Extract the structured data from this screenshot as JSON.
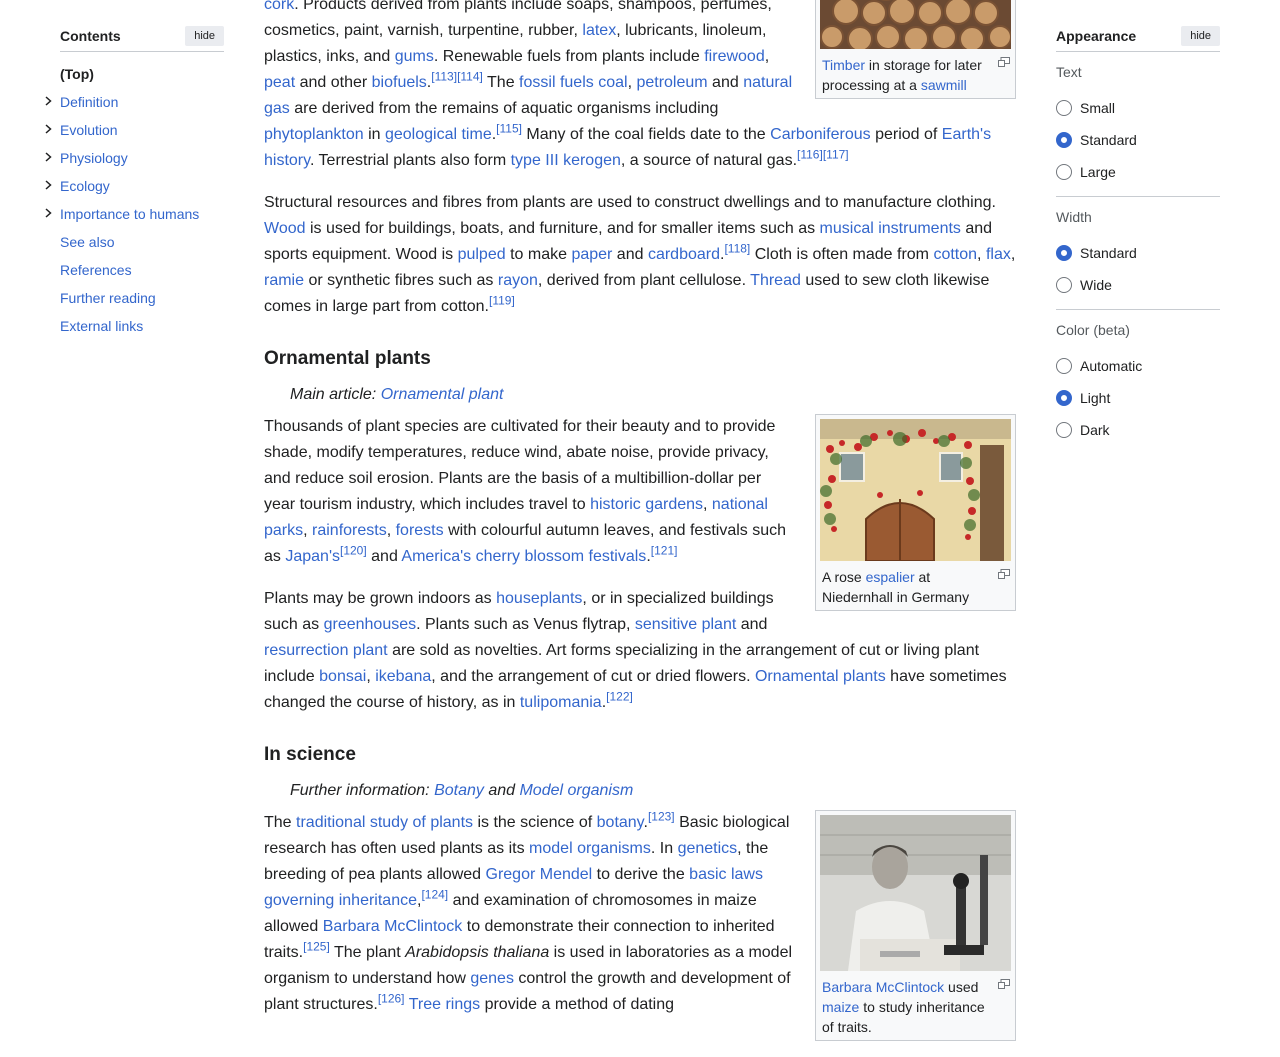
{
  "toc": {
    "title": "Contents",
    "hide_label": "hide",
    "top": "(Top)",
    "items": [
      {
        "label": "Definition",
        "expandable": true
      },
      {
        "label": "Evolution",
        "expandable": true
      },
      {
        "label": "Physiology",
        "expandable": true
      },
      {
        "label": "Ecology",
        "expandable": true
      },
      {
        "label": "Importance to humans",
        "expandable": true
      },
      {
        "label": "See also",
        "expandable": false
      },
      {
        "label": "References",
        "expandable": false
      },
      {
        "label": "Further reading",
        "expandable": false
      },
      {
        "label": "External links",
        "expandable": false
      }
    ]
  },
  "appearance": {
    "title": "Appearance",
    "hide_label": "hide",
    "text": {
      "label": "Text",
      "options": [
        "Small",
        "Standard",
        "Large"
      ],
      "selected": "Standard"
    },
    "width": {
      "label": "Width",
      "options": [
        "Standard",
        "Wide"
      ],
      "selected": "Standard"
    },
    "color": {
      "label": "Color (beta)",
      "options": [
        "Automatic",
        "Light",
        "Dark"
      ],
      "selected": "Light"
    }
  },
  "figures": {
    "timber": {
      "caption_link": "Timber",
      "caption_text": " in storage for later processing at a ",
      "caption_link2": "sawmill"
    },
    "rose": {
      "caption_pre": "A rose ",
      "caption_link": "espalier",
      "caption_text": " at Niedernhall in Germany"
    },
    "mcclintock": {
      "caption_link": "Barbara McClintock",
      "caption_text": " used ",
      "caption_link2": "maize",
      "caption_text2": " to study inheritance of traits."
    }
  },
  "article": {
    "p1": [
      {
        "t": "cork",
        "link": true
      },
      {
        "t": ". Products derived from plants include soaps, shampoos, perfumes, cosmetics, paint, varnish, turpentine, rubber, "
      },
      {
        "t": "latex",
        "link": true
      },
      {
        "t": ", lubricants, linoleum, plastics, inks, and "
      },
      {
        "t": "gums",
        "link": true
      },
      {
        "t": ". Renewable fuels from plants include "
      },
      {
        "t": "firewood",
        "link": true
      },
      {
        "t": ", "
      },
      {
        "t": "peat",
        "link": true
      },
      {
        "t": " and other "
      },
      {
        "t": "biofuels",
        "link": true
      },
      {
        "t": "."
      },
      {
        "t": "[113]",
        "link": true,
        "sup": true
      },
      {
        "t": "[114]",
        "link": true,
        "sup": true
      },
      {
        "t": " The "
      },
      {
        "t": "fossil fuels",
        "link": true
      },
      {
        "t": " "
      },
      {
        "t": "coal",
        "link": true
      },
      {
        "t": ", "
      },
      {
        "t": "petroleum",
        "link": true
      },
      {
        "t": " and "
      },
      {
        "t": "natural gas",
        "link": true
      },
      {
        "t": " are derived from the remains of aquatic organisms including "
      },
      {
        "t": "phytoplankton",
        "link": true
      },
      {
        "t": " in "
      },
      {
        "t": "geological time",
        "link": true
      },
      {
        "t": "."
      },
      {
        "t": "[115]",
        "link": true,
        "sup": true
      },
      {
        "t": " Many of the coal fields date to the "
      },
      {
        "t": "Carboniferous",
        "link": true
      },
      {
        "t": " period of "
      },
      {
        "t": "Earth's history",
        "link": true
      },
      {
        "t": ". Terrestrial plants also form "
      },
      {
        "t": "type III kerogen",
        "link": true
      },
      {
        "t": ", a source of natural gas."
      },
      {
        "t": "[116]",
        "link": true,
        "sup": true
      },
      {
        "t": "[117]",
        "link": true,
        "sup": true
      }
    ],
    "p2": [
      {
        "t": "Structural resources and fibres from plants are used to construct dwellings and to manufacture clothing. "
      },
      {
        "t": "Wood",
        "link": true
      },
      {
        "t": " is used for buildings, boats, and furniture, and for smaller items such as "
      },
      {
        "t": "musical instruments",
        "link": true
      },
      {
        "t": " and sports equipment. Wood is "
      },
      {
        "t": "pulped",
        "link": true
      },
      {
        "t": " to make "
      },
      {
        "t": "paper",
        "link": true
      },
      {
        "t": " and "
      },
      {
        "t": "cardboard",
        "link": true
      },
      {
        "t": "."
      },
      {
        "t": "[118]",
        "link": true,
        "sup": true
      },
      {
        "t": " Cloth is often made from "
      },
      {
        "t": "cotton",
        "link": true
      },
      {
        "t": ", "
      },
      {
        "t": "flax",
        "link": true
      },
      {
        "t": ", "
      },
      {
        "t": "ramie",
        "link": true
      },
      {
        "t": " or synthetic fibres such as "
      },
      {
        "t": "rayon",
        "link": true
      },
      {
        "t": ", derived from plant cellulose. "
      },
      {
        "t": "Thread",
        "link": true
      },
      {
        "t": " used to sew cloth likewise comes in large part from cotton."
      },
      {
        "t": "[119]",
        "link": true,
        "sup": true
      }
    ],
    "h_ornamental": "Ornamental plants",
    "hat_ornamental": [
      {
        "t": "Main article: "
      },
      {
        "t": "Ornamental plant",
        "link": true
      }
    ],
    "p3": [
      {
        "t": "Thousands of plant species are cultivated for their beauty and to provide shade, modify temperatures, reduce wind, abate noise, provide privacy, and reduce soil erosion. Plants are the basis of a multibillion-dollar per year tourism industry, which includes travel to "
      },
      {
        "t": "historic gardens",
        "link": true
      },
      {
        "t": ", "
      },
      {
        "t": "national parks",
        "link": true
      },
      {
        "t": ", "
      },
      {
        "t": "rainforests",
        "link": true
      },
      {
        "t": ", "
      },
      {
        "t": "forests",
        "link": true
      },
      {
        "t": " with colourful autumn leaves, and festivals such as "
      },
      {
        "t": "Japan's",
        "link": true
      },
      {
        "t": "[120]",
        "link": true,
        "sup": true
      },
      {
        "t": " and "
      },
      {
        "t": "America's cherry blossom festivals",
        "link": true
      },
      {
        "t": "."
      },
      {
        "t": "[121]",
        "link": true,
        "sup": true
      }
    ],
    "p4": [
      {
        "t": "Plants may be grown indoors as "
      },
      {
        "t": "houseplants",
        "link": true
      },
      {
        "t": ", or in specialized buildings such as "
      },
      {
        "t": "greenhouses",
        "link": true
      },
      {
        "t": ". Plants such as Venus flytrap, "
      },
      {
        "t": "sensitive plant",
        "link": true
      },
      {
        "t": " and "
      },
      {
        "t": "resurrection plant",
        "link": true
      },
      {
        "t": " are sold as novelties. Art forms specializing in the arrangement of cut or living plant include "
      },
      {
        "t": "bonsai",
        "link": true
      },
      {
        "t": ", "
      },
      {
        "t": "ikebana",
        "link": true
      },
      {
        "t": ", and the arrangement of cut or dried flowers. "
      },
      {
        "t": "Ornamental plants",
        "link": true
      },
      {
        "t": " have sometimes changed the course of history, as in "
      },
      {
        "t": "tulipomania",
        "link": true
      },
      {
        "t": "."
      },
      {
        "t": "[122]",
        "link": true,
        "sup": true
      }
    ],
    "h_science": "In science",
    "hat_science": [
      {
        "t": "Further information: "
      },
      {
        "t": "Botany",
        "link": true
      },
      {
        "t": " and "
      },
      {
        "t": "Model organism",
        "link": true
      }
    ],
    "p5": [
      {
        "t": "The "
      },
      {
        "t": "traditional study of plants",
        "link": true
      },
      {
        "t": " is the science of "
      },
      {
        "t": "botany",
        "link": true
      },
      {
        "t": "."
      },
      {
        "t": "[123]",
        "link": true,
        "sup": true
      },
      {
        "t": " Basic biological research has often used plants as its "
      },
      {
        "t": "model organisms",
        "link": true
      },
      {
        "t": ". In "
      },
      {
        "t": "genetics",
        "link": true
      },
      {
        "t": ", the breeding of pea plants allowed "
      },
      {
        "t": "Gregor Mendel",
        "link": true
      },
      {
        "t": " to derive the "
      },
      {
        "t": "basic laws governing inheritance",
        "link": true
      },
      {
        "t": ","
      },
      {
        "t": "[124]",
        "link": true,
        "sup": true
      },
      {
        "t": " and examination of chromosomes in maize allowed "
      },
      {
        "t": "Barbara McClintock",
        "link": true
      },
      {
        "t": " to demonstrate their connection to inherited traits."
      },
      {
        "t": "[125]",
        "link": true,
        "sup": true
      },
      {
        "t": " The plant "
      },
      {
        "t": "Arabidopsis thaliana",
        "em": true
      },
      {
        "t": " is used in laboratories as a model organism to understand how "
      },
      {
        "t": "genes",
        "link": true
      },
      {
        "t": " control the growth and development of plant structures."
      },
      {
        "t": "[126]",
        "link": true,
        "sup": true
      },
      {
        "t": " "
      },
      {
        "t": "Tree rings",
        "link": true
      },
      {
        "t": " provide a method of dating"
      }
    ]
  }
}
